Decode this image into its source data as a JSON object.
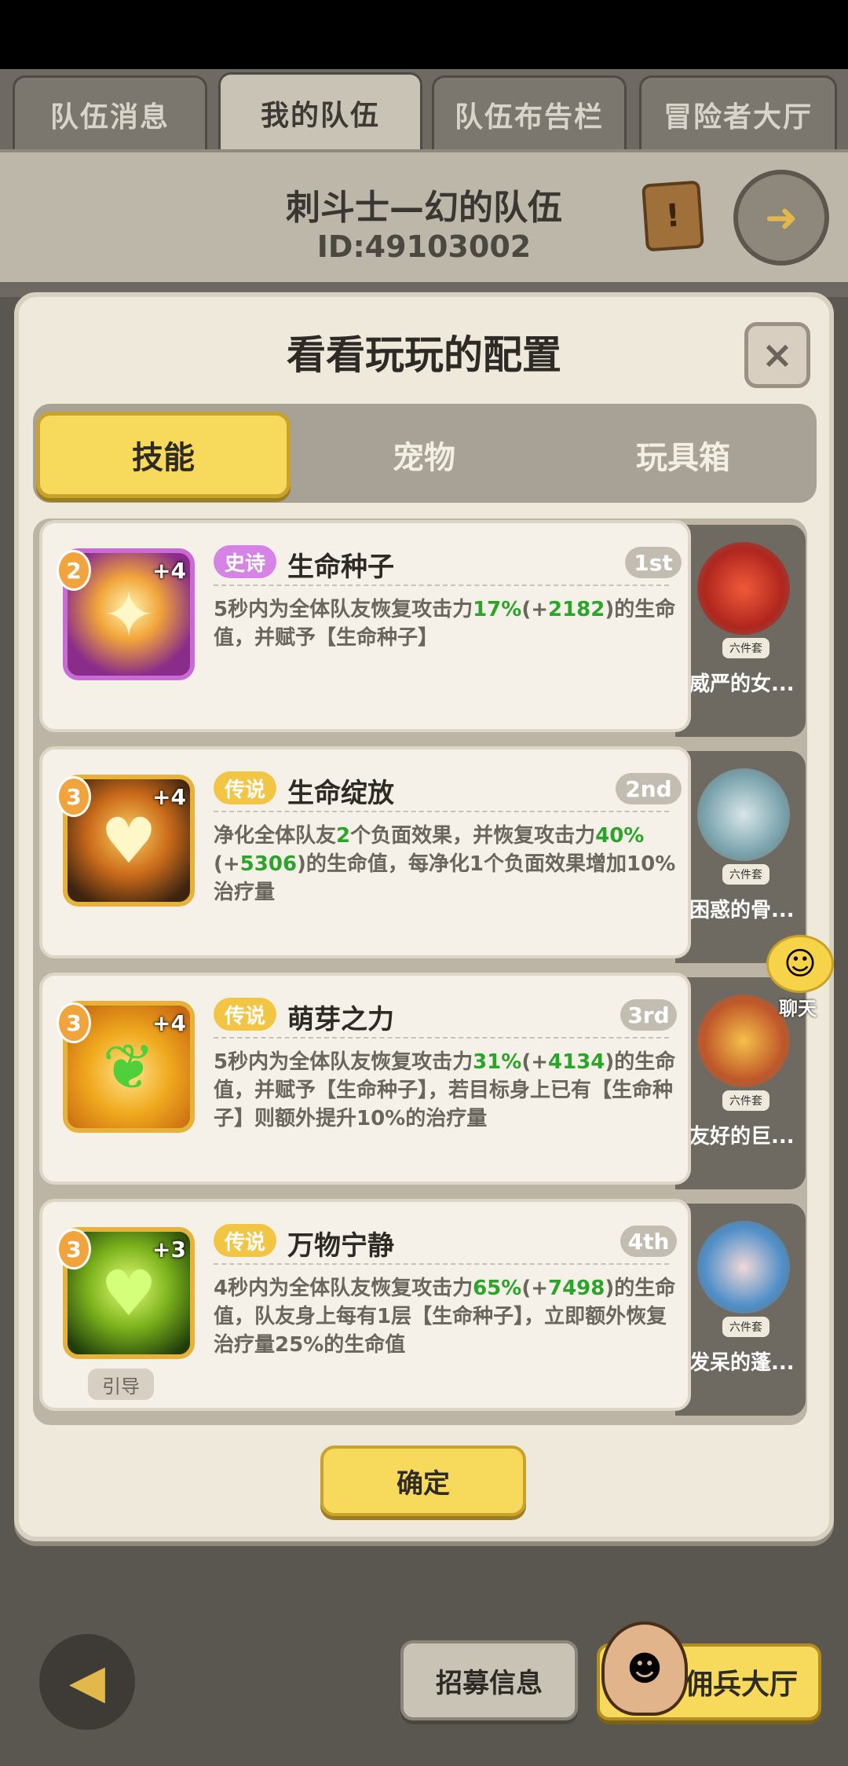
{
  "tabs": [
    {
      "label": "队伍消息"
    },
    {
      "label": "我的队伍"
    },
    {
      "label": "队伍布告栏"
    },
    {
      "label": "冒险者大厅"
    }
  ],
  "team": {
    "name": "刺斗士—幻的队伍",
    "id": "ID:49103002"
  },
  "dialog": {
    "title": "看看玩玩的配置",
    "close_label": "×",
    "segments": [
      {
        "label": "技能"
      },
      {
        "label": "宠物"
      },
      {
        "label": "玩具箱"
      }
    ],
    "skills": [
      {
        "level": "2",
        "plus": "+4",
        "rarity": "史诗",
        "name": "生命种子",
        "rank": "1st",
        "desc": [
          "5秒内为全体队友恢复攻击力",
          "17%",
          "(+",
          "2182",
          ")的生命值，并赋予【生命种子】"
        ],
        "pet": {
          "tag": "六件套",
          "name": "威严的女..."
        }
      },
      {
        "level": "3",
        "plus": "+4",
        "rarity": "传说",
        "name": "生命绽放",
        "rank": "2nd",
        "desc": [
          "净化全体队友",
          "2",
          "个负面效果，并恢复攻击力",
          "40%",
          "(+",
          "5306",
          ")的生命值，每净化1个负面效果增加10%治疗量"
        ],
        "pet": {
          "tag": "六件套",
          "name": "困惑的骨..."
        }
      },
      {
        "level": "3",
        "plus": "+4",
        "rarity": "传说",
        "name": "萌芽之力",
        "rank": "3rd",
        "desc": [
          "5秒内为全体队友恢复攻击力",
          "31%",
          "(+",
          "4134",
          ")的生命值，并赋予【生命种子】，若目标身上已有【生命种子】则额外提升10%的治疗量"
        ],
        "pet": {
          "tag": "六件套",
          "name": "友好的巨..."
        }
      },
      {
        "level": "3",
        "plus": "+3",
        "rarity": "传说",
        "name": "万物宁静",
        "rank": "4th",
        "desc": [
          "4秒内为全体队友恢复攻击力",
          "65%",
          "(+",
          "7498",
          ")的生命值，队友身上每有1层【生命种子】，立即额外恢复治疗量25%的生命值"
        ],
        "pet": {
          "tag": "六件套",
          "name": "发呆的蓬..."
        }
      }
    ],
    "guide_label": "引导",
    "confirm_label": "确定"
  },
  "chat": {
    "label": "聊天"
  },
  "bottom": {
    "recruit_label": "招募信息",
    "merc_label": "佣兵大厅"
  },
  "colors": {
    "accent_yellow": "#f7d95c",
    "epic_purple": "#d683e6",
    "legend_gold": "#f2c545",
    "value_green": "#2aa52a"
  }
}
